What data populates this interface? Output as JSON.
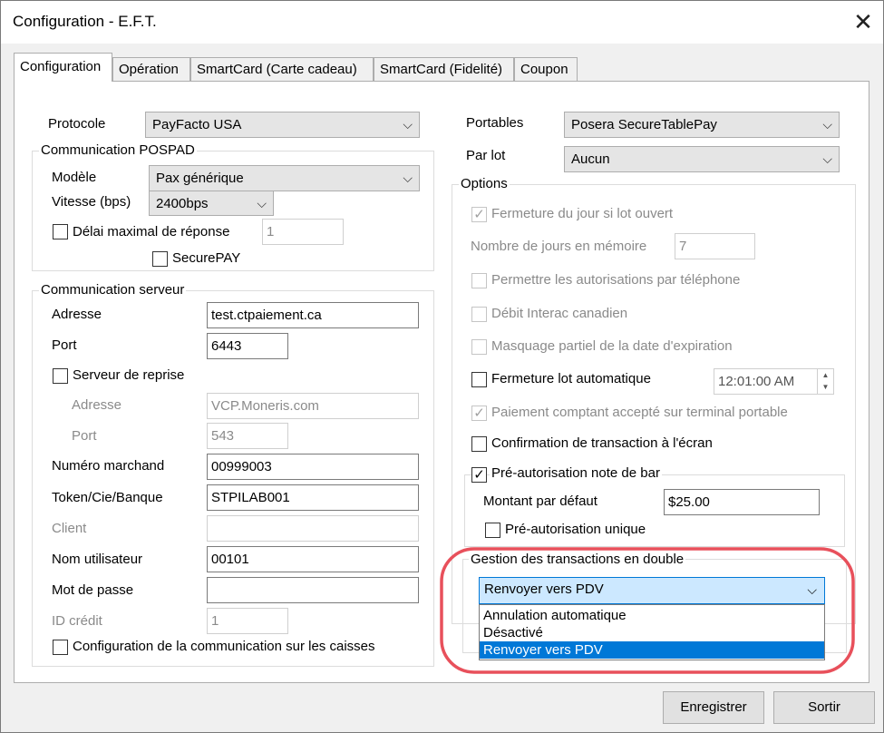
{
  "window": {
    "title": "Configuration - E.F.T.",
    "close_icon": "close-icon"
  },
  "tabs": [
    "Configuration",
    "Opération",
    "SmartCard (Carte cadeau)",
    "SmartCard (Fidelité)",
    "Coupon"
  ],
  "left": {
    "protocole_label": "Protocole",
    "protocole_value": "PayFacto USA",
    "pospad_group": "Communication POSPAD",
    "modele_label": "Modèle",
    "modele_value": "Pax générique",
    "vitesse_label": "Vitesse (bps)",
    "vitesse_value": "2400bps",
    "delai_label": "Délai maximal de réponse",
    "delai_value": "1",
    "securepay_label": "SecurePAY",
    "serveur_group": "Communication serveur",
    "adresse_label": "Adresse",
    "adresse_value": "test.ctpaiement.ca",
    "port_label": "Port",
    "port_value": "6443",
    "reprise_label": "Serveur de reprise",
    "reprise_adresse_label": "Adresse",
    "reprise_adresse_value": "VCP.Moneris.com",
    "reprise_port_label": "Port",
    "reprise_port_value": "543",
    "marchand_label": "Numéro marchand",
    "marchand_value": "00999003",
    "token_label": "Token/Cie/Banque",
    "token_value": "STPILAB001",
    "client_label": "Client",
    "client_value": "",
    "utilisateur_label": "Nom utilisateur",
    "utilisateur_value": "00101",
    "motdepasse_label": "Mot de passe",
    "motdepasse_value": "",
    "idcredit_label": "ID crédit",
    "idcredit_value": "1",
    "config_caisses_label": "Configuration de la communication sur les caisses"
  },
  "right": {
    "portables_label": "Portables",
    "portables_value": "Posera SecureTablePay",
    "parlot_label": "Par lot",
    "parlot_value": "Aucun",
    "options_group": "Options",
    "fermeture_jour_label": "Fermeture du jour si lot ouvert",
    "nb_jours_label": "Nombre de jours en mémoire",
    "nb_jours_value": "7",
    "autorisations_tel_label": "Permettre les autorisations par téléphone",
    "interac_label": "Débit Interac canadien",
    "masquage_label": "Masquage partiel de la date d'expiration",
    "fermeture_lot_label": "Fermeture lot automatique",
    "fermeture_lot_time": "12:01:00 AM",
    "paiement_comptant_label": "Paiement comptant accepté sur terminal portable",
    "confirmation_label": "Confirmation de transaction à l'écran",
    "preauth_label": "Pré-autorisation note de bar",
    "montant_label": "Montant par défaut",
    "montant_value": "$25.00",
    "preauth_unique_label": "Pré-autorisation unique",
    "gestion_group": "Gestion des transactions en double",
    "gestion_selected": "Renvoyer vers PDV",
    "gestion_options": [
      "Annulation automatique",
      "Désactivé",
      "Renvoyer vers PDV"
    ]
  },
  "buttons": {
    "save": "Enregistrer",
    "exit": "Sortir"
  },
  "colors": {
    "highlight": "#0078d7",
    "annotation_circle": "#e8505b"
  }
}
